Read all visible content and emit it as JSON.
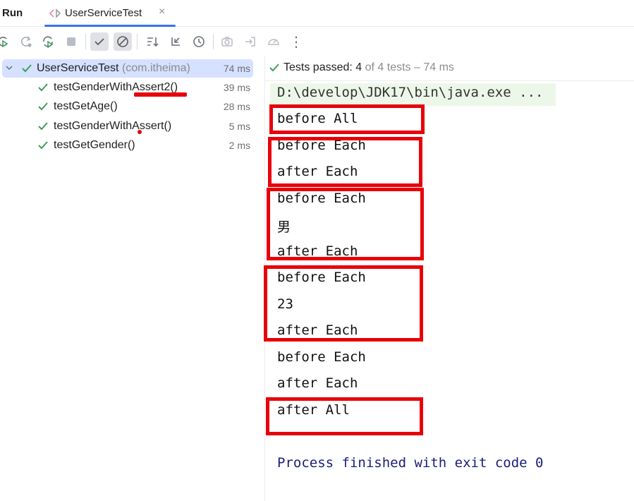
{
  "tool_window": {
    "title": "Run"
  },
  "tab": {
    "title": "UserServiceTest",
    "close_glyph": "×",
    "icon": "run-config-icon"
  },
  "toolbar": {
    "icons": [
      "rerun-icon",
      "rerun-failed-icon",
      "toggle-autotest-icon",
      "stop-icon",
      "show-passed-icon",
      "show-ignored-icon",
      "sort-icon",
      "collapse-icon",
      "history-icon",
      "screenshot-icon",
      "export-icon",
      "coverage-icon",
      "more-icon"
    ],
    "more_glyph": "⋮"
  },
  "tree": {
    "root": {
      "name": "UserServiceTest",
      "package": "(com.itheima)",
      "time": "74 ms"
    },
    "items": [
      {
        "name": "testGenderWithAssert2()",
        "time": "39 ms"
      },
      {
        "name": "testGetAge()",
        "time": "28 ms"
      },
      {
        "name": "testGenderWithAssert()",
        "time": "5 ms"
      },
      {
        "name": "testGetGender()",
        "time": "2 ms"
      }
    ]
  },
  "status": {
    "prefix": "Tests passed: ",
    "passed": "4",
    "suffix": " of 4 tests – 74 ms"
  },
  "console": {
    "lines": [
      "D:\\develop\\JDK17\\bin\\java.exe ...",
      "before All",
      "before Each",
      "after Each",
      "before Each",
      "男",
      "after Each",
      "before Each",
      "23",
      "after Each",
      "before Each",
      "after Each",
      "after All",
      "Process finished with exit code 0"
    ]
  },
  "colors": {
    "accent": "#3574f0",
    "pass": "#3f9d5c",
    "annotation_red": "#e8000b",
    "selection": "#d5e1ff",
    "process_text": "#1a1d7a"
  }
}
